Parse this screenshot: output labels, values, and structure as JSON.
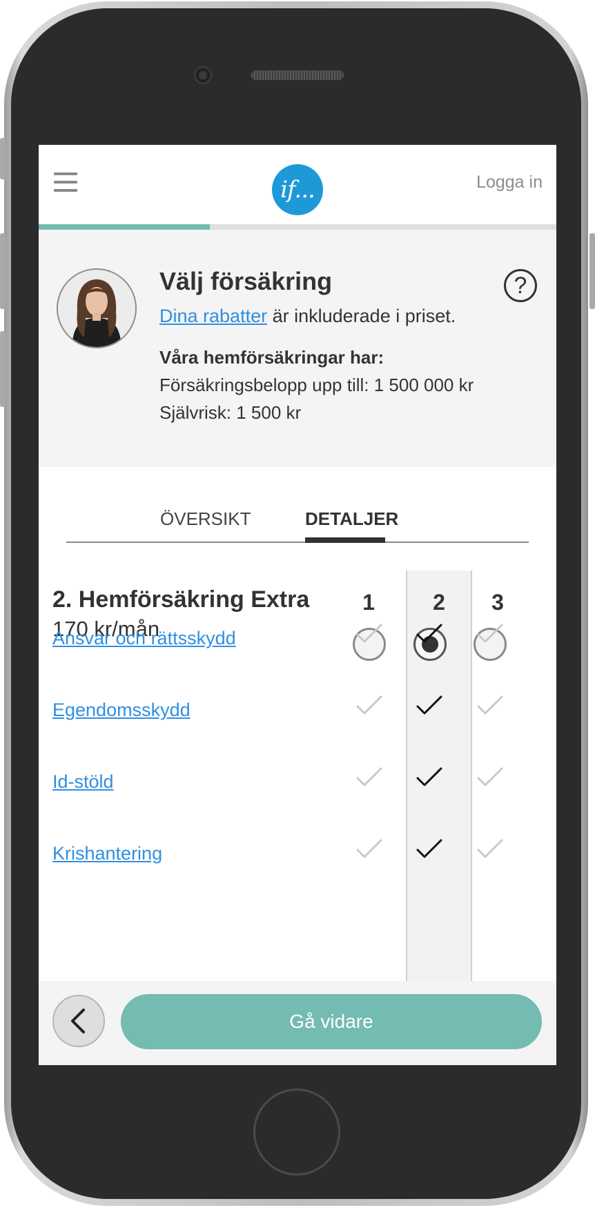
{
  "topbar": {
    "logo_text": "if...",
    "login_label": "Logga in"
  },
  "progress": {
    "fraction": 0.33
  },
  "header": {
    "title": "Välj försäkring",
    "discount_link": "Dina rabatter",
    "discount_rest": " är inkluderade i priset.",
    "features_title": "Våra hemförsäkringar har:",
    "coverage_line": "Försäkringsbelopp upp till: 1 500 000 kr",
    "deductible_line": "Självrisk: 1 500 kr",
    "help_glyph": "?"
  },
  "tabs": [
    {
      "label": "ÖVERSIKT",
      "active": false
    },
    {
      "label": "DETALJER",
      "active": true
    }
  ],
  "plan": {
    "name": "2. Hemförsäkring Extra",
    "price": "170 kr/mån",
    "columns": [
      "1",
      "2",
      "3"
    ],
    "selected_column": "2"
  },
  "features": [
    {
      "label": "Ansvar och rättsskydd",
      "included": [
        true,
        true,
        true
      ]
    },
    {
      "label": "Egendomsskydd",
      "included": [
        true,
        true,
        true
      ]
    },
    {
      "label": "Id-stöld",
      "included": [
        true,
        true,
        true
      ]
    },
    {
      "label": "Krishantering",
      "included": [
        true,
        true,
        true
      ]
    }
  ],
  "footer": {
    "back_icon": "chevron-left-icon",
    "next_label": "Gå vidare"
  },
  "colors": {
    "accent": "#74bbb1",
    "link": "#2f8fe0",
    "logo": "#1d99d8"
  }
}
